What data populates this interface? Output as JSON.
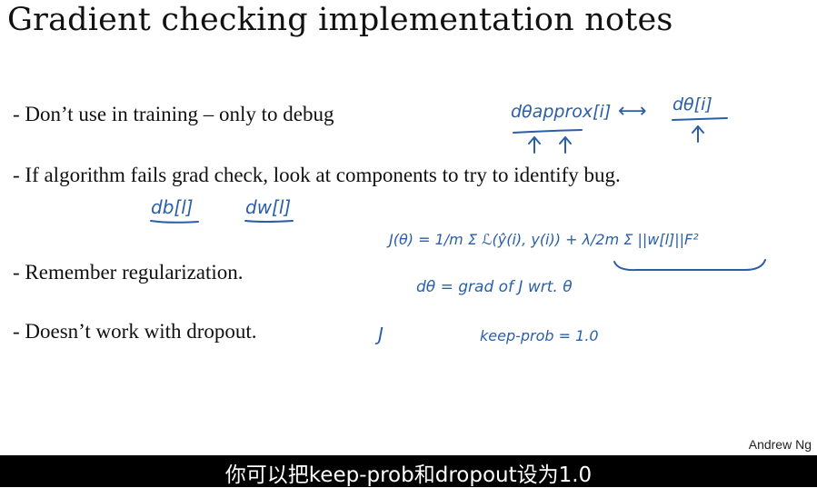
{
  "title": "Gradient checking implementation notes",
  "bullets": [
    "- Don’t use in training – only to debug",
    "- If algorithm fails grad check, look at components to try to identify bug.",
    "- Remember regularization.",
    "- Doesn’t work with dropout."
  ],
  "annotations": {
    "dtheta_approx": "dθapprox[i]",
    "arrow": "⟷",
    "dtheta_i": "dθ[i]",
    "db": "db[l]",
    "dw": "dw[l]",
    "cost_function": "J(θ) = 1/m Σ ℒ(ŷ(i), y(i)) + λ/2m Σ ||w[l]||F²",
    "dtheta_grad": "dθ = grad of J wrt. θ",
    "j_symbol": "J",
    "keep_prob": "keep-prob = 1.0"
  },
  "author": "Andrew Ng",
  "subtitle": "你可以把keep-prob和dropout设为1.0",
  "colors": {
    "ink": "#2a5fa8",
    "background": "#ffffff",
    "subtitle_bar": "#000000"
  }
}
